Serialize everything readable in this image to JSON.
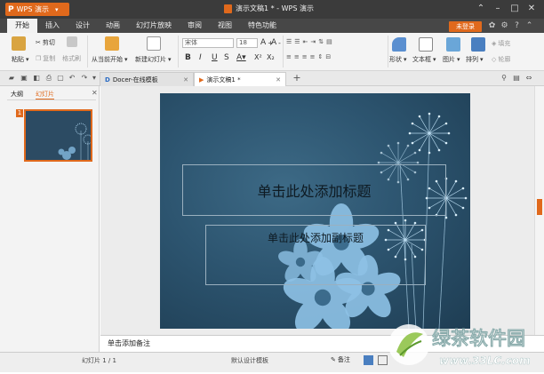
{
  "titlebar": {
    "app_label": "WPS 演示",
    "doc_title": "演示文稿1 * - WPS 演示"
  },
  "menu": {
    "items": [
      "开始",
      "插入",
      "设计",
      "动画",
      "幻灯片放映",
      "审阅",
      "视图",
      "特色功能"
    ],
    "login": "未登录"
  },
  "ribbon": {
    "paste": "粘贴",
    "cut": "剪切",
    "copy": "复制",
    "format_painter": "格式刷",
    "from_current": "从当前开始",
    "new_slide": "新建幻灯片",
    "font_name": "宋体",
    "font_size": "18",
    "shape": "形状",
    "textbox": "文本框",
    "picture": "图片",
    "arrange": "排列",
    "fill": "填充",
    "outline": "轮廓"
  },
  "tabs": [
    {
      "label": "Docer-在线模板"
    },
    {
      "label": "演示文稿1 *"
    }
  ],
  "panel": {
    "tab_outline": "大纲",
    "tab_slides": "幻灯片",
    "slide_number": "1"
  },
  "slide": {
    "title_placeholder": "单击此处添加标题",
    "subtitle_placeholder": "单击此处添加副标题"
  },
  "notes": {
    "placeholder": "单击添加备注"
  },
  "status": {
    "slide_count": "幻灯片 1 / 1",
    "template": "默认设计模板",
    "notes_btn": "备注"
  },
  "watermark": {
    "text": "绿茶软件园",
    "url": "www.33LC.com"
  },
  "colors": {
    "accent": "#e0691c",
    "titlebar": "#3b3b3b",
    "slide_bg": "#2d5570"
  }
}
